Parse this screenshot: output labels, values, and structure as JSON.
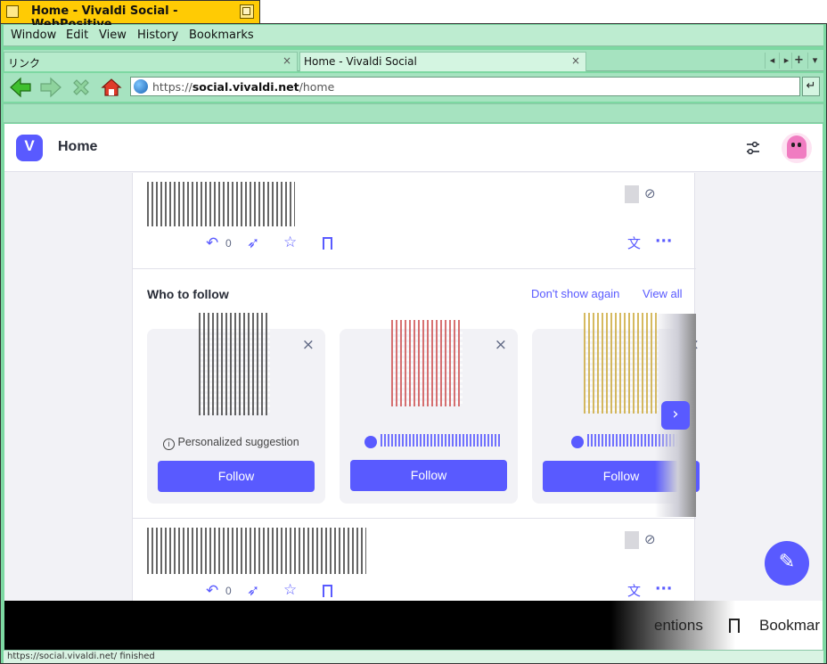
{
  "window": {
    "title": "Home - Vivaldi Social - WebPositive"
  },
  "menu": {
    "items": [
      "Window",
      "Edit",
      "View",
      "History",
      "Bookmarks"
    ]
  },
  "tabs": [
    {
      "label": "リンク",
      "close": "×"
    },
    {
      "label": "Home - Vivaldi Social",
      "close": "×"
    }
  ],
  "tab_controls": [
    "◂",
    "▸",
    "+",
    "▾"
  ],
  "nav": {
    "url_prefix": "https://",
    "url_host": "social.vivaldi.net",
    "url_path": "/home",
    "go": "↵"
  },
  "app": {
    "title": "Home",
    "compose_icon": "✎"
  },
  "post1": {
    "reply_count": "0"
  },
  "who_to_follow": {
    "title": "Who to follow",
    "dont_show_again": "Don't show again",
    "view_all": "View all",
    "cards": [
      {
        "note": "Personalized suggestion",
        "follow": "Follow",
        "dismiss": "×"
      },
      {
        "follow": "Follow",
        "dismiss": "×"
      },
      {
        "follow": "Follow",
        "dismiss": "×"
      }
    ],
    "next": "›"
  },
  "post2": {
    "reply_count": "0"
  },
  "bottom_nav": {
    "mentions": "entions",
    "bookmarks": "Bookmar"
  },
  "status": {
    "text": "https://social.vivaldi.net/ finished"
  },
  "colors": {
    "accent": "#595aff",
    "chrome": "#a6e3c0",
    "title_tab": "#ffcb04"
  }
}
